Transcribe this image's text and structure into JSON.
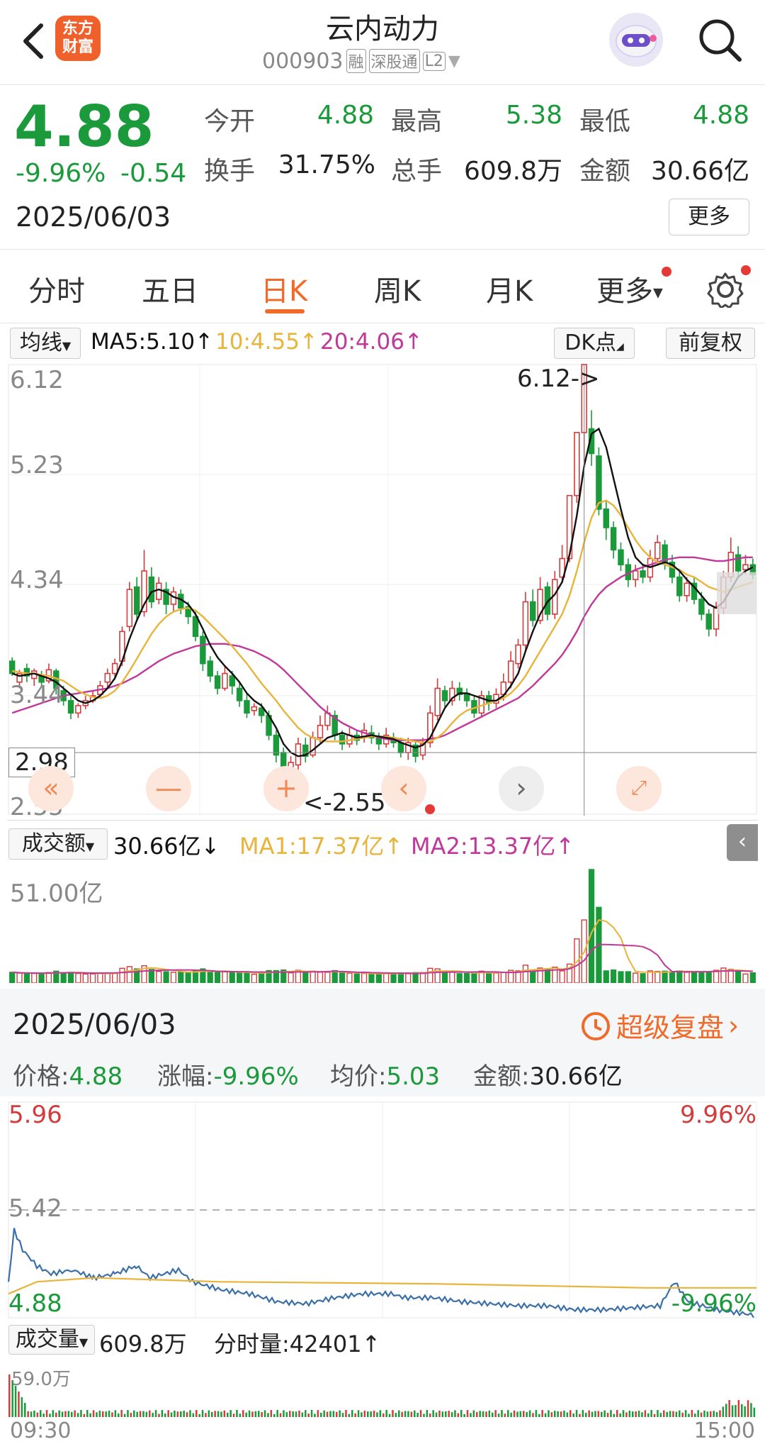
{
  "header": {
    "back_label": "<",
    "logo_line1": "东方",
    "logo_line2": "财富",
    "stock_name": "云内动力",
    "stock_code": "000903",
    "tag_rong": "融",
    "tag_sgt": "深股通",
    "tag_level": "L2"
  },
  "quote": {
    "price": "4.88",
    "change_pct": "-9.96%",
    "change": "-0.54",
    "date": "2025/06/03",
    "open_label": "今开",
    "open": "4.88",
    "high_label": "最高",
    "high": "5.38",
    "low_label": "最低",
    "low": "4.88",
    "turnover_label": "换手",
    "turnover": "31.75%",
    "volume_label": "总手",
    "volume": "609.8万",
    "amount_label": "金额",
    "amount": "30.66亿",
    "more_button": "更多"
  },
  "tabs": [
    {
      "label": "分时"
    },
    {
      "label": "五日"
    },
    {
      "label": "日K"
    },
    {
      "label": "周K"
    },
    {
      "label": "月K"
    },
    {
      "label": "更多"
    }
  ],
  "kline_bar": {
    "ma_select": "均线",
    "ma5": "MA5:5.10",
    "ma10": "10:4.55",
    "ma20": "20:4.06",
    "dk_button": "DK点",
    "adjust_button": "前复权"
  },
  "kline_axis": {
    "y_top": "6.12",
    "y_2": "5.23",
    "y_3": "4.34",
    "y_4": "3.44",
    "y_cross": "2.98",
    "y_bottom": "2.55",
    "max_marker": "6.12->",
    "min_marker": "<-2.55"
  },
  "volume_bar": {
    "select": "成交额",
    "value": "30.66亿",
    "ma1": "MA1:17.37亿",
    "ma2": "MA2:13.37亿",
    "y_top": "51.00亿"
  },
  "detail": {
    "date": "2025/06/03",
    "replay_link": "超级复盘",
    "price_label": "价格:",
    "price": "4.88",
    "pct_label": "涨幅:",
    "pct": "-9.96%",
    "avg_label": "均价:",
    "avg": "5.03",
    "amount_label": "金额:",
    "amount": "30.66亿"
  },
  "intraday_axis": {
    "y_top": "5.96",
    "y_mid": "5.42",
    "y_bottom": "4.88",
    "pct_top": "9.96%",
    "pct_bottom": "-9.96%",
    "vol_select": "成交量",
    "vol_total": "609.8万",
    "vol_tick_label": "分时量:",
    "vol_tick": "42401",
    "vol_top": "59.0万",
    "time_start": "09:30",
    "time_end": "15:00"
  },
  "colors": {
    "up": "#d23c3c",
    "down": "#1a9a3a",
    "ma5": "#111111",
    "ma10": "#e8b43a",
    "ma20": "#c0389a",
    "accent": "#f06a2a"
  },
  "chart_data": {
    "type": "candlestick",
    "ylim": [
      2.55,
      6.12
    ],
    "candles": [
      [
        3.72,
        3.62,
        3.75,
        3.6
      ],
      [
        3.55,
        3.62,
        3.65,
        3.5
      ],
      [
        3.66,
        3.6,
        3.7,
        3.55
      ],
      [
        3.58,
        3.64,
        3.66,
        3.52
      ],
      [
        3.6,
        3.55,
        3.64,
        3.52
      ],
      [
        3.56,
        3.65,
        3.7,
        3.54
      ],
      [
        3.64,
        3.5,
        3.66,
        3.45
      ],
      [
        3.48,
        3.4,
        3.52,
        3.36
      ],
      [
        3.4,
        3.3,
        3.44,
        3.25
      ],
      [
        3.3,
        3.36,
        3.38,
        3.26
      ],
      [
        3.36,
        3.4,
        3.44,
        3.33
      ],
      [
        3.4,
        3.44,
        3.48,
        3.38
      ],
      [
        3.45,
        3.52,
        3.56,
        3.42
      ],
      [
        3.55,
        3.62,
        3.66,
        3.5
      ],
      [
        3.62,
        3.7,
        3.74,
        3.58
      ],
      [
        3.72,
        3.96,
        4.0,
        3.68
      ],
      [
        4.0,
        4.3,
        4.36,
        3.96
      ],
      [
        4.32,
        4.1,
        4.4,
        4.05
      ],
      [
        4.12,
        4.45,
        4.62,
        4.08
      ],
      [
        4.4,
        4.2,
        4.48,
        4.15
      ],
      [
        4.22,
        4.35,
        4.4,
        4.18
      ],
      [
        4.3,
        4.18,
        4.36,
        4.1
      ],
      [
        4.18,
        4.28,
        4.32,
        4.12
      ],
      [
        4.26,
        4.15,
        4.3,
        4.1
      ],
      [
        4.16,
        4.08,
        4.2,
        4.02
      ],
      [
        4.08,
        3.92,
        4.12,
        3.88
      ],
      [
        3.92,
        3.7,
        3.96,
        3.64
      ],
      [
        3.72,
        3.6,
        3.76,
        3.55
      ],
      [
        3.6,
        3.5,
        3.64,
        3.45
      ],
      [
        3.5,
        3.62,
        3.68,
        3.48
      ],
      [
        3.6,
        3.52,
        3.64,
        3.45
      ],
      [
        3.5,
        3.4,
        3.55,
        3.35
      ],
      [
        3.4,
        3.3,
        3.46,
        3.26
      ],
      [
        3.32,
        3.35,
        3.38,
        3.28
      ],
      [
        3.34,
        3.28,
        3.38,
        3.22
      ],
      [
        3.28,
        3.12,
        3.32,
        3.08
      ],
      [
        3.12,
        2.96,
        3.16,
        2.9
      ],
      [
        2.98,
        2.8,
        3.02,
        2.74
      ],
      [
        2.82,
        2.9,
        2.95,
        2.6
      ],
      [
        2.88,
        3.05,
        3.1,
        2.55
      ],
      [
        3.04,
        2.95,
        3.1,
        2.9
      ],
      [
        2.96,
        3.1,
        3.15,
        2.94
      ],
      [
        3.1,
        3.2,
        3.28,
        3.06
      ],
      [
        3.2,
        3.3,
        3.36,
        3.16
      ],
      [
        3.28,
        3.12,
        3.32,
        3.08
      ],
      [
        3.12,
        3.05,
        3.16,
        3.0
      ],
      [
        3.05,
        3.12,
        3.18,
        3.02
      ],
      [
        3.12,
        3.08,
        3.16,
        3.04
      ],
      [
        3.1,
        3.16,
        3.22,
        3.06
      ],
      [
        3.14,
        3.1,
        3.2,
        3.05
      ],
      [
        3.1,
        3.05,
        3.14,
        3.0
      ],
      [
        3.05,
        3.12,
        3.18,
        3.02
      ],
      [
        3.1,
        3.06,
        3.14,
        3.02
      ],
      [
        3.06,
        2.98,
        3.1,
        2.94
      ],
      [
        2.98,
        3.06,
        3.1,
        2.92
      ],
      [
        3.04,
        2.95,
        3.08,
        2.9
      ],
      [
        2.96,
        3.05,
        3.1,
        2.92
      ],
      [
        3.06,
        3.3,
        3.36,
        3.02
      ],
      [
        3.28,
        3.5,
        3.58,
        3.24
      ],
      [
        3.48,
        3.4,
        3.52,
        3.35
      ],
      [
        3.4,
        3.5,
        3.56,
        3.36
      ],
      [
        3.5,
        3.45,
        3.55,
        3.4
      ],
      [
        3.46,
        3.4,
        3.5,
        3.35
      ],
      [
        3.4,
        3.3,
        3.44,
        3.26
      ],
      [
        3.3,
        3.44,
        3.48,
        3.26
      ],
      [
        3.44,
        3.38,
        3.48,
        3.32
      ],
      [
        3.38,
        3.45,
        3.5,
        3.34
      ],
      [
        3.45,
        3.55,
        3.62,
        3.4
      ],
      [
        3.55,
        3.72,
        3.8,
        3.5
      ],
      [
        3.7,
        3.85,
        3.9,
        3.66
      ],
      [
        3.85,
        4.2,
        4.28,
        3.8
      ],
      [
        4.2,
        4.05,
        4.3,
        4.0
      ],
      [
        4.05,
        4.3,
        4.4,
        4.02
      ],
      [
        4.32,
        4.1,
        4.36,
        4.05
      ],
      [
        4.1,
        4.38,
        4.45,
        4.06
      ],
      [
        4.4,
        4.55,
        4.66,
        4.36
      ],
      [
        4.55,
        5.06,
        5.06,
        4.52
      ],
      [
        5.06,
        5.57,
        5.57,
        5.0
      ],
      [
        5.57,
        6.12,
        6.12,
        5.3
      ],
      [
        5.6,
        5.4,
        5.75,
        5.3
      ],
      [
        5.38,
        4.95,
        5.45,
        4.9
      ],
      [
        4.95,
        4.8,
        5.02,
        4.7
      ],
      [
        4.8,
        4.62,
        4.85,
        4.55
      ],
      [
        4.62,
        4.5,
        4.68,
        4.45
      ],
      [
        4.5,
        4.38,
        4.55,
        4.32
      ],
      [
        4.38,
        4.45,
        4.5,
        4.32
      ],
      [
        4.45,
        4.4,
        4.5,
        4.35
      ],
      [
        4.4,
        4.55,
        4.62,
        4.36
      ],
      [
        4.55,
        4.68,
        4.74,
        4.5
      ],
      [
        4.66,
        4.52,
        4.7,
        4.46
      ],
      [
        4.52,
        4.4,
        4.58,
        4.35
      ],
      [
        4.4,
        4.25,
        4.45,
        4.2
      ],
      [
        4.25,
        4.35,
        4.4,
        4.2
      ],
      [
        4.35,
        4.22,
        4.4,
        4.18
      ],
      [
        4.22,
        4.1,
        4.28,
        4.05
      ],
      [
        4.1,
        3.98,
        4.14,
        3.92
      ],
      [
        3.98,
        4.15,
        4.2,
        3.92
      ],
      [
        4.15,
        4.4,
        4.45,
        4.1
      ],
      [
        4.4,
        4.6,
        4.72,
        4.36
      ],
      [
        4.58,
        4.45,
        4.65,
        4.4
      ],
      [
        4.46,
        4.5,
        4.58,
        4.42
      ],
      [
        4.5,
        4.42,
        4.55,
        4.38
      ]
    ],
    "ma5": [
      3.62,
      3.6,
      3.61,
      3.62,
      3.6,
      3.58,
      3.55,
      3.5,
      3.45,
      3.4,
      3.38,
      3.4,
      3.44,
      3.5,
      3.58,
      3.72,
      3.9,
      4.05,
      4.18,
      4.28,
      4.3,
      4.28,
      4.24,
      4.22,
      4.18,
      4.1,
      3.98,
      3.85,
      3.75,
      3.68,
      3.62,
      3.55,
      3.46,
      3.4,
      3.36,
      3.28,
      3.18,
      3.05,
      2.98,
      2.95,
      2.96,
      3.0,
      3.05,
      3.1,
      3.12,
      3.14,
      3.12,
      3.1,
      3.11,
      3.12,
      3.11,
      3.1,
      3.09,
      3.06,
      3.04,
      3.02,
      3.04,
      3.1,
      3.22,
      3.34,
      3.42,
      3.46,
      3.46,
      3.44,
      3.42,
      3.4,
      3.4,
      3.44,
      3.52,
      3.62,
      3.8,
      3.96,
      4.1,
      4.2,
      4.26,
      4.36,
      4.58,
      4.9,
      5.3,
      5.56,
      5.6,
      5.45,
      5.2,
      4.95,
      4.72,
      4.56,
      4.5,
      4.48,
      4.5,
      4.52,
      4.5,
      4.45,
      4.38,
      4.32,
      4.25,
      4.18,
      4.15,
      4.2,
      4.3,
      4.4,
      4.45,
      4.48
    ],
    "ma10": [
      3.64,
      3.63,
      3.62,
      3.62,
      3.61,
      3.6,
      3.58,
      3.56,
      3.52,
      3.48,
      3.45,
      3.43,
      3.42,
      3.44,
      3.48,
      3.55,
      3.64,
      3.74,
      3.84,
      3.94,
      4.02,
      4.08,
      4.12,
      4.14,
      4.15,
      4.13,
      4.08,
      4.02,
      3.96,
      3.9,
      3.84,
      3.77,
      3.7,
      3.62,
      3.54,
      3.47,
      3.4,
      3.32,
      3.25,
      3.18,
      3.13,
      3.1,
      3.08,
      3.07,
      3.07,
      3.07,
      3.08,
      3.09,
      3.1,
      3.11,
      3.11,
      3.11,
      3.1,
      3.09,
      3.08,
      3.07,
      3.06,
      3.07,
      3.1,
      3.15,
      3.22,
      3.28,
      3.32,
      3.34,
      3.36,
      3.38,
      3.4,
      3.42,
      3.46,
      3.52,
      3.6,
      3.7,
      3.8,
      3.9,
      4.0,
      4.1,
      4.25,
      4.45,
      4.68,
      4.88,
      5.0,
      5.02,
      4.98,
      4.9,
      4.8,
      4.7,
      4.62,
      4.56,
      4.52,
      4.5,
      4.48,
      4.46,
      4.42,
      4.4,
      4.36,
      4.32,
      4.3,
      4.28,
      4.3,
      4.32,
      4.34,
      4.36
    ],
    "ma20": [
      3.3,
      3.32,
      3.34,
      3.36,
      3.38,
      3.4,
      3.42,
      3.44,
      3.45,
      3.46,
      3.47,
      3.48,
      3.49,
      3.5,
      3.52,
      3.54,
      3.57,
      3.6,
      3.64,
      3.68,
      3.72,
      3.75,
      3.78,
      3.8,
      3.82,
      3.84,
      3.85,
      3.86,
      3.86,
      3.86,
      3.85,
      3.84,
      3.82,
      3.8,
      3.77,
      3.74,
      3.7,
      3.65,
      3.59,
      3.53,
      3.47,
      3.41,
      3.35,
      3.3,
      3.26,
      3.22,
      3.19,
      3.16,
      3.14,
      3.12,
      3.1,
      3.09,
      3.08,
      3.08,
      3.08,
      3.08,
      3.08,
      3.09,
      3.1,
      3.12,
      3.15,
      3.18,
      3.21,
      3.24,
      3.27,
      3.3,
      3.33,
      3.36,
      3.39,
      3.42,
      3.47,
      3.52,
      3.58,
      3.64,
      3.7,
      3.77,
      3.86,
      3.96,
      4.08,
      4.18,
      4.26,
      4.32,
      4.36,
      4.4,
      4.43,
      4.46,
      4.48,
      4.5,
      4.52,
      4.54,
      4.55,
      4.56,
      4.56,
      4.56,
      4.55,
      4.54,
      4.53,
      4.53,
      4.54,
      4.55,
      4.56,
      4.56
    ]
  }
}
